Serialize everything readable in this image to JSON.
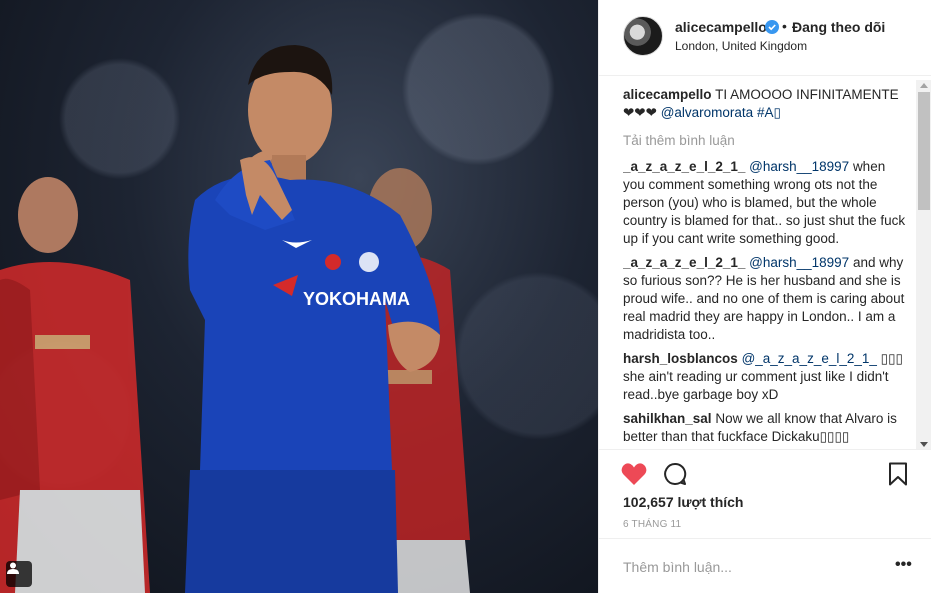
{
  "post": {
    "username": "alicecampello",
    "follow_status": "Đang theo dõi",
    "dot": "•",
    "location": "London, United Kingdom",
    "likes": "102,657 lượt thích",
    "date": "6 THÁNG 11",
    "comment_placeholder": "Thêm bình luận...",
    "more": "•••",
    "colors": {
      "heart": "#ed4956",
      "verified": "#3897f0",
      "mention": "#003569"
    }
  },
  "caption": {
    "user": "alicecampello",
    "text": "TI AMOOOO INFINITAMENTE ❤❤❤",
    "mention": "@alvaromorata",
    "hashtag": "#A▯"
  },
  "load_more": "Tải thêm bình luận",
  "comments": [
    {
      "user": "_a_z_a_z_e_l_2_1_",
      "mention": "@harsh__18997",
      "text": "when you comment something wrong ots not the person (you) who is blamed, but the whole country is blamed for that.. so just shut the fuck up if you cant write something good."
    },
    {
      "user": "_a_z_a_z_e_l_2_1_",
      "mention": "@harsh__18997",
      "text": "and why so furious son?? He is her husband and she is proud wife.. and no one of them is caring about real madrid they are happy in London.. I am a madridista too.."
    },
    {
      "user": "harsh_losblancos",
      "mention": "@_a_z_a_z_e_l_2_1_",
      "text": "▯▯▯ she ain't reading ur comment just like I didn't read..bye garbage boy xD"
    },
    {
      "user": "sahilkhan_sal",
      "mention": "",
      "text": "Now we all know that Alvaro is better than that fuckface Dickaku▯▯▯▯"
    }
  ],
  "icons": {
    "avatar": "avatar-image",
    "verified": "verified-badge-icon",
    "like": "heart-icon",
    "comment": "comment-bubble-icon",
    "save": "bookmark-icon",
    "tag": "user-tag-icon"
  }
}
